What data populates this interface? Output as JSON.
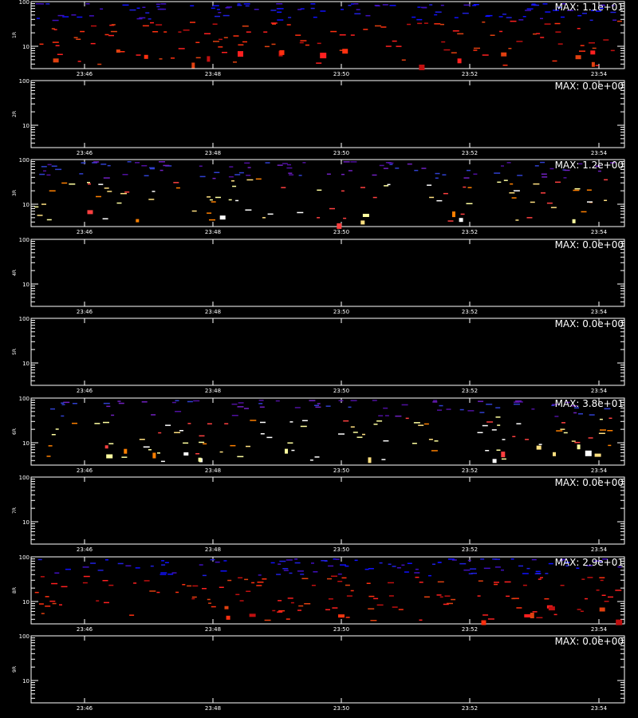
{
  "chart_data": {
    "type": "heatmap",
    "x_ticks": [
      "23:46",
      "23:48",
      "23:50",
      "23:52",
      "23:54"
    ],
    "y_ticks": [
      "100",
      "10"
    ],
    "y_scale": "log",
    "panels": [
      {
        "label": "1R",
        "max_text": "MAX: 1.1e+01",
        "palette": "blue-red",
        "density": "high",
        "seed": 11
      },
      {
        "label": "2R",
        "max_text": "MAX: 0.0e+00",
        "palette": "none",
        "density": "none",
        "seed": 0
      },
      {
        "label": "3R",
        "max_text": "MAX: 1.2e+00",
        "palette": "purple-yellow",
        "density": "medium",
        "seed": 23
      },
      {
        "label": "4R",
        "max_text": "MAX: 0.0e+00",
        "palette": "none",
        "density": "none",
        "seed": 0
      },
      {
        "label": "5R",
        "max_text": "MAX: 0.0e+00",
        "palette": "none",
        "density": "none",
        "seed": 0
      },
      {
        "label": "6R",
        "max_text": "MAX: 3.8e+01",
        "palette": "purple-yellow",
        "density": "medium",
        "seed": 37
      },
      {
        "label": "7R",
        "max_text": "MAX: 0.0e+00",
        "palette": "none",
        "density": "none",
        "seed": 0
      },
      {
        "label": "8R",
        "max_text": "MAX: 2.9e+01",
        "palette": "blue-red",
        "density": "high",
        "seed": 53
      },
      {
        "label": "9R",
        "max_text": "MAX: 0.0e+00",
        "palette": "none",
        "density": "none",
        "seed": 0
      }
    ]
  },
  "footer_text": ""
}
